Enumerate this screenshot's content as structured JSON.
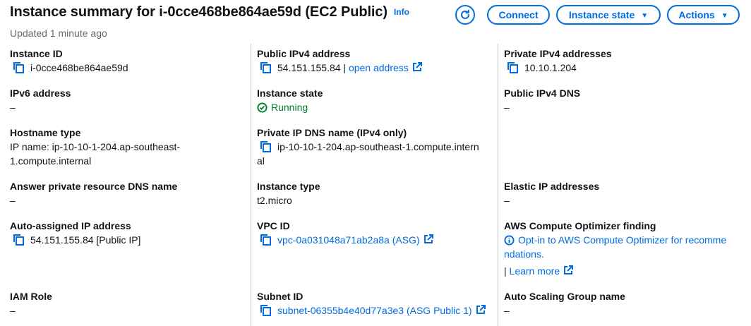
{
  "header": {
    "title": "Instance summary for i-0cce468be864ae59d (EC2 Public)",
    "info": "Info",
    "updated": "Updated 1 minute ago"
  },
  "toolbar": {
    "refresh_icon": "refresh-icon",
    "connect": "Connect",
    "instance_state": "Instance state",
    "actions": "Actions"
  },
  "fields": {
    "instance_id": {
      "label": "Instance ID",
      "value": "i-0cce468be864ae59d"
    },
    "public_ipv4": {
      "label": "Public IPv4 address",
      "value": "54.151.155.84",
      "sep": " | ",
      "link": "open address"
    },
    "private_ipv4": {
      "label": "Private IPv4 addresses",
      "value": "10.10.1.204"
    },
    "ipv6": {
      "label": "IPv6 address",
      "value": "–"
    },
    "instance_state": {
      "label": "Instance state",
      "value": "Running"
    },
    "public_dns": {
      "label": "Public IPv4 DNS",
      "value": "–"
    },
    "hostname_type": {
      "label": "Hostname type",
      "line1": "IP name: ip-10-10-1-204.ap-southeast-",
      "line2": "1.compute.internal"
    },
    "private_dns": {
      "label": "Private IP DNS name (IPv4 only)",
      "line1": "ip-10-10-1-204.ap-southeast-1.compute.intern",
      "line2": "al"
    },
    "answer_dns": {
      "label": "Answer private resource DNS name",
      "value": "–"
    },
    "instance_type": {
      "label": "Instance type",
      "value": "t2.micro"
    },
    "elastic_ip": {
      "label": "Elastic IP addresses",
      "value": "–"
    },
    "auto_ip": {
      "label": "Auto-assigned IP address",
      "value": "54.151.155.84 [Public IP]"
    },
    "vpc_id": {
      "label": "VPC ID",
      "value": "vpc-0a031048a71ab2a8a (ASG)"
    },
    "optimizer": {
      "label": "AWS Compute Optimizer finding",
      "line1": "Opt-in to AWS Compute Optimizer for recomme",
      "line2": "ndations.",
      "sep": "| ",
      "learn": "Learn more"
    },
    "iam_role": {
      "label": "IAM Role",
      "value": "–"
    },
    "subnet_id": {
      "label": "Subnet ID",
      "value": "subnet-06355b4e40d77a3e3 (ASG Public 1)"
    },
    "asg_name": {
      "label": "Auto Scaling Group name",
      "value": "–"
    }
  },
  "colors": {
    "link": "#006ce0",
    "success": "#00802f",
    "text": "#0f141a",
    "muted": "#656871"
  }
}
